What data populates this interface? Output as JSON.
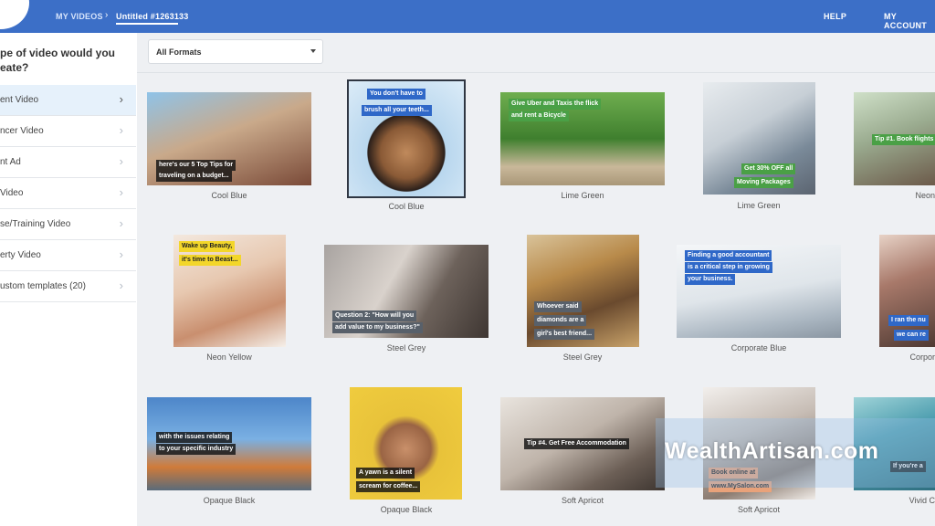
{
  "header": {
    "breadcrumb_root": "MY VIDEOS",
    "breadcrumb_sep": "›",
    "breadcrumb_current": "Untitled #1263133",
    "help": "HELP",
    "account": "MY ACCOUNT"
  },
  "sidebar": {
    "question": "pe of video would you\neate?",
    "items": [
      {
        "label": "ent Video"
      },
      {
        "label": "ncer Video"
      },
      {
        "label": "nt Ad"
      },
      {
        "label": "Video"
      },
      {
        "label": "se/Training Video"
      },
      {
        "label": "erty Video"
      },
      {
        "label": "ustom templates (20)"
      }
    ]
  },
  "filter": {
    "format_value": "All Formats"
  },
  "templates": [
    {
      "caption": "Cool Blue",
      "overlay": [
        "here's our 5 Top Tips for",
        "traveling on a budget..."
      ]
    },
    {
      "caption": "Cool Blue",
      "overlay": [
        "You don't have to",
        "brush all your teeth..."
      ]
    },
    {
      "caption": "Lime Green",
      "overlay": [
        "Give Uber and Taxis the flick",
        "and rent a Bicycle"
      ]
    },
    {
      "caption": "Lime Green",
      "overlay": [
        "Get 30% OFF all",
        "Moving Packages"
      ]
    },
    {
      "caption": "Neon",
      "overlay": [
        "Tip #1. Book flights"
      ]
    },
    {
      "caption": "Neon Yellow",
      "overlay": [
        "Wake up Beauty,",
        "it's time to Beast..."
      ]
    },
    {
      "caption": "Steel Grey",
      "overlay": [
        "Question 2: \"How will you",
        "add value to my business?\""
      ]
    },
    {
      "caption": "Steel Grey",
      "overlay": [
        "Whoever said",
        "diamonds are a",
        "girl's best friend..."
      ]
    },
    {
      "caption": "Corporate Blue",
      "overlay": [
        "Finding a good accountant",
        "is a critical step in growing",
        "your business."
      ]
    },
    {
      "caption": "Corpor",
      "overlay": [
        "I ran the nu",
        "we can re"
      ]
    },
    {
      "caption": "Opaque Black",
      "overlay": [
        "with the issues relating",
        "to your specific industry"
      ]
    },
    {
      "caption": "Opaque Black",
      "overlay": [
        "A yawn is a silent",
        "scream for coffee..."
      ]
    },
    {
      "caption": "Soft Apricot",
      "overlay": [
        "Tip #4. Get Free Accommodation"
      ]
    },
    {
      "caption": "Soft Apricot",
      "overlay": [
        "Book online at",
        "www.MySalon.com"
      ]
    },
    {
      "caption": "Vivid C",
      "overlay": [
        "If you're a"
      ]
    }
  ],
  "watermark": "WealthArtisan.com"
}
